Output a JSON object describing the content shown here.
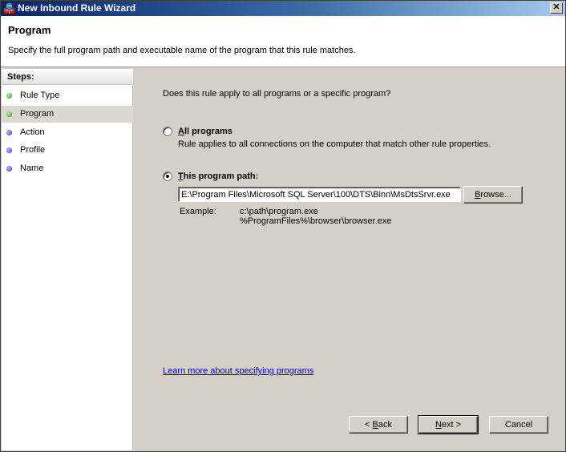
{
  "window": {
    "title": "New Inbound Rule Wizard",
    "close_label": "✕"
  },
  "header": {
    "title": "Program",
    "subtitle": "Specify the full program path and executable name of the program that this rule matches."
  },
  "steps": {
    "title": "Steps:",
    "items": [
      {
        "label": "Rule Type",
        "status": "completed",
        "color": "#2f9a25"
      },
      {
        "label": "Program",
        "status": "current",
        "color": "#2f9a25"
      },
      {
        "label": "Action",
        "status": "pending",
        "color": "#3a3ab8"
      },
      {
        "label": "Profile",
        "status": "pending",
        "color": "#3a3ab8"
      },
      {
        "label": "Name",
        "status": "pending",
        "color": "#3a3ab8"
      }
    ]
  },
  "content": {
    "question": "Does this rule apply to all programs or a specific program?",
    "all_programs": {
      "label_mnemonic": "A",
      "label_rest": "ll programs",
      "description": "Rule applies to all connections on the computer that match other rule properties.",
      "checked": false
    },
    "program_path": {
      "label_mnemonic": "T",
      "label_rest": "his program path:",
      "checked": true,
      "value": "E:\\Program Files\\Microsoft SQL Server\\100\\DTS\\Binn\\MsDtsSrvr.exe",
      "browse_mnemonic": "B",
      "browse_rest": "rowse..."
    },
    "example": {
      "label": "Example:",
      "line1": "c:\\path\\program.exe",
      "line2": "%ProgramFiles%\\browser\\browser.exe"
    },
    "learn_more": "Learn more about specifying programs"
  },
  "buttons": {
    "back_prefix": "< ",
    "back_mnemonic": "B",
    "back_rest": "ack",
    "next_mnemonic": "N",
    "next_rest": "ext >",
    "cancel": "Cancel"
  }
}
